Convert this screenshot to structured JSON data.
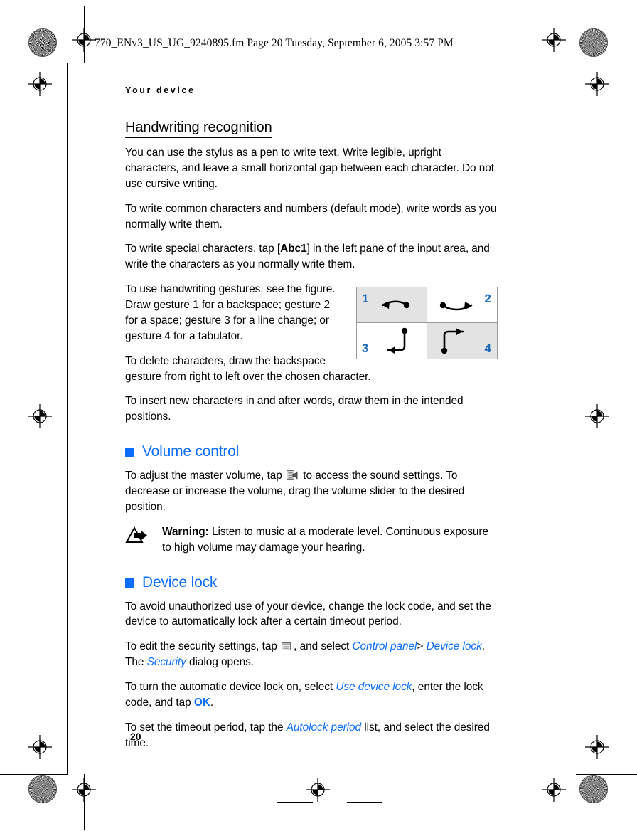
{
  "page": {
    "fm_header": "770_ENv3_US_UG_9240895.fm  Page 20  Tuesday, September 6, 2005  3:57 PM",
    "running_header": "Your device",
    "page_number": "20"
  },
  "colors": {
    "heading_blue": "#0d6efd",
    "figure_number_blue": "#1a6ab5",
    "figure_gray": "#e3e3e3",
    "text_black": "#000000"
  },
  "handwriting": {
    "heading": "Handwriting recognition",
    "p1": "You can use the stylus as a pen to write text. Write legible, upright characters, and leave a small horizontal gap between each character. Do not use cursive writing.",
    "p2": "To write common characters and numbers (default mode), write words as you normally write them.",
    "p3_a": "To write special characters, tap [",
    "p3_bold": "Abc1",
    "p3_b": "] in the left pane of the input area, and write the characters as you normally write them.",
    "p4": "To use handwriting gestures, see the figure. Draw gesture 1 for a backspace; gesture 2 for a space; gesture 3 for a line change; or gesture 4 for a tabulator.",
    "p5": "To delete characters, draw the backspace gesture from right to left over the chosen character.",
    "p6": "To insert new characters in and after words, draw them in the intended positions."
  },
  "gesture_figure": {
    "cells": [
      {
        "number": "1",
        "gesture": "arrow-left",
        "background": "gray",
        "number_position": "top-left"
      },
      {
        "number": "2",
        "gesture": "arrow-right",
        "background": "white",
        "number_position": "top-right"
      },
      {
        "number": "3",
        "gesture": "arrow-down-then-left",
        "background": "white",
        "number_position": "bottom-left"
      },
      {
        "number": "4",
        "gesture": "arrow-up-then-right",
        "background": "gray",
        "number_position": "bottom-right"
      }
    ]
  },
  "volume": {
    "heading": "Volume control",
    "p1_a": "To adjust the master volume, tap",
    "p1_b": "to access the sound settings. To decrease or increase the volume, drag the volume slider to the desired position.",
    "icon_name": "sound-settings-icon",
    "warning_label": "Warning:",
    "warning_text": " Listen to music at a moderate level. Continuous exposure to high volume may damage your hearing.",
    "warning_icon_name": "warning-triangle-icon"
  },
  "device_lock": {
    "heading": "Device lock",
    "p1": "To avoid unauthorized use of your device, change the lock code, and set the device to automatically lock after a certain timeout period.",
    "p2_a": "To edit the security settings, tap",
    "p2_b": ", and select",
    "p2_ui1": "Control panel",
    "p2_sep": ">",
    "p2_ui2": "Device lock",
    "p2_c": ". The",
    "p2_ui3": "Security",
    "p2_d": "dialog opens.",
    "icon_name": "control-panel-icon",
    "p3_a": "To turn the automatic device lock on, select",
    "p3_ui1": "Use device lock",
    "p3_b": ", enter the lock code, and tap",
    "p3_ui2": "OK",
    "p3_c": ".",
    "p4_a": "To set the timeout period, tap the",
    "p4_ui1": "Autolock period",
    "p4_b": "list, and select the desired time."
  }
}
